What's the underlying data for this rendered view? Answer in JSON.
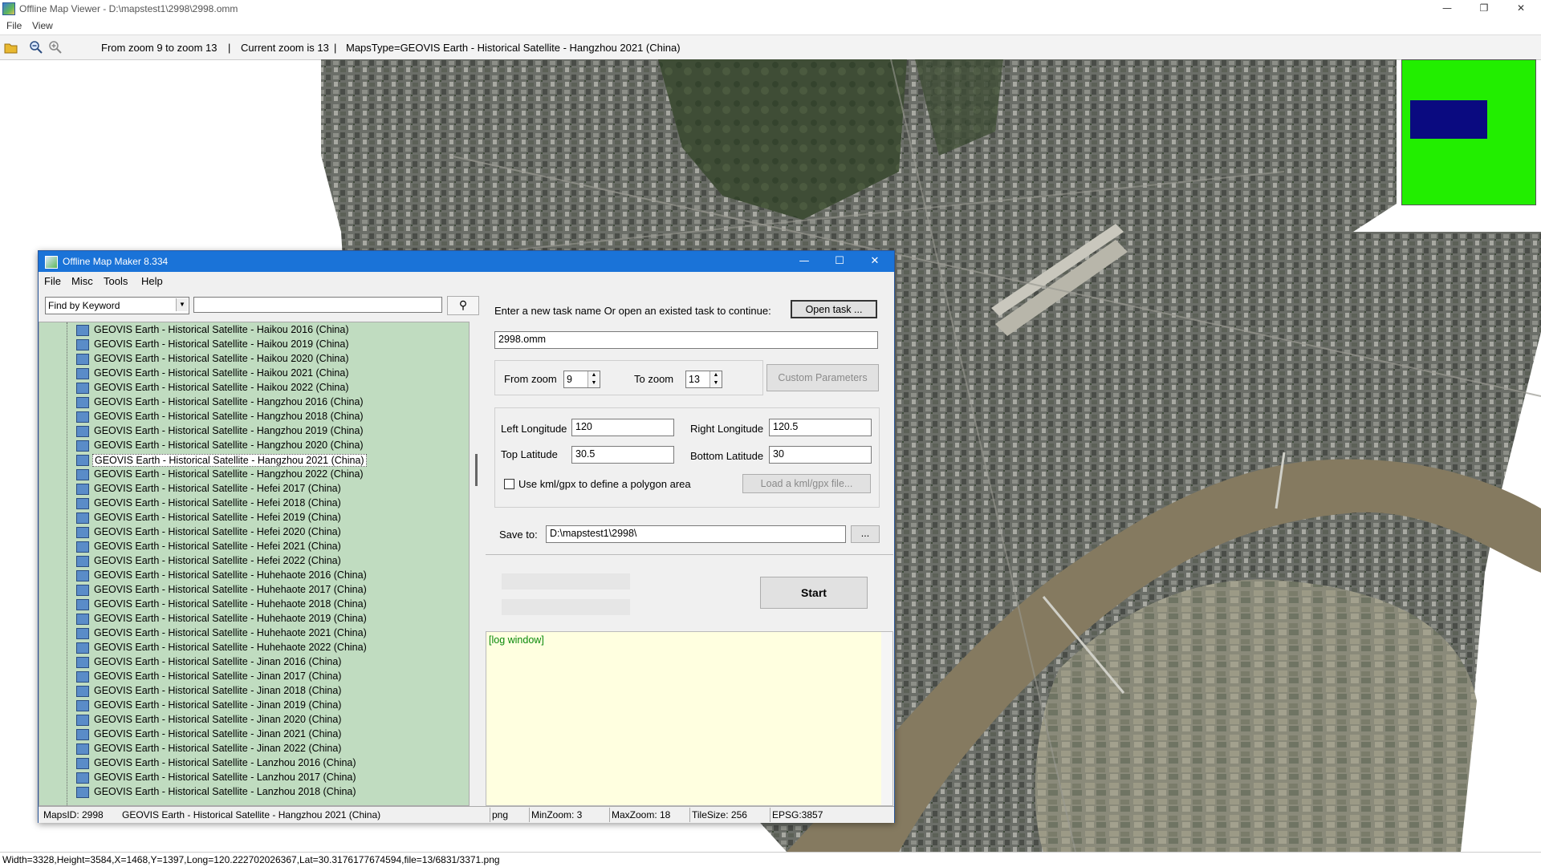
{
  "window": {
    "title": "Offline Map Viewer - D:\\mapstest1\\2998\\2998.omm"
  },
  "menu": [
    "File",
    "View"
  ],
  "toolbar": {
    "zoom_range": "From zoom 9 to zoom 13",
    "current_zoom": "Current zoom is 13",
    "maps_type": "MapsType=GEOVIS Earth - Historical Satellite - Hangzhou 2021 (China)"
  },
  "status": "Width=3328,Height=3584,X=1468,Y=1397,Long=120.222702026367,Lat=30.3176177674594,file=13/6831/3371.png",
  "dialog": {
    "title": "Offline Map Maker 8.334",
    "menu": [
      "File",
      "Misc",
      "Tools",
      "Help"
    ],
    "find_by": "Find by Keyword",
    "search_value": "",
    "tree_items": [
      "GEOVIS Earth - Historical Satellite - Haikou 2016 (China)",
      "GEOVIS Earth - Historical Satellite - Haikou 2019 (China)",
      "GEOVIS Earth - Historical Satellite - Haikou 2020 (China)",
      "GEOVIS Earth - Historical Satellite - Haikou 2021 (China)",
      "GEOVIS Earth - Historical Satellite - Haikou 2022 (China)",
      "GEOVIS Earth - Historical Satellite - Hangzhou 2016 (China)",
      "GEOVIS Earth - Historical Satellite - Hangzhou 2018 (China)",
      "GEOVIS Earth - Historical Satellite - Hangzhou 2019 (China)",
      "GEOVIS Earth - Historical Satellite - Hangzhou 2020 (China)",
      "GEOVIS Earth - Historical Satellite - Hangzhou 2021 (China)",
      "GEOVIS Earth - Historical Satellite - Hangzhou 2022 (China)",
      "GEOVIS Earth - Historical Satellite - Hefei 2017 (China)",
      "GEOVIS Earth - Historical Satellite - Hefei 2018 (China)",
      "GEOVIS Earth - Historical Satellite - Hefei 2019 (China)",
      "GEOVIS Earth - Historical Satellite - Hefei 2020 (China)",
      "GEOVIS Earth - Historical Satellite - Hefei 2021 (China)",
      "GEOVIS Earth - Historical Satellite - Hefei 2022 (China)",
      "GEOVIS Earth - Historical Satellite - Huhehaote 2016 (China)",
      "GEOVIS Earth - Historical Satellite - Huhehaote 2017 (China)",
      "GEOVIS Earth - Historical Satellite - Huhehaote 2018 (China)",
      "GEOVIS Earth - Historical Satellite - Huhehaote 2019 (China)",
      "GEOVIS Earth - Historical Satellite - Huhehaote 2021 (China)",
      "GEOVIS Earth - Historical Satellite - Huhehaote 2022 (China)",
      "GEOVIS Earth - Historical Satellite - Jinan 2016 (China)",
      "GEOVIS Earth - Historical Satellite - Jinan 2017 (China)",
      "GEOVIS Earth - Historical Satellite - Jinan 2018 (China)",
      "GEOVIS Earth - Historical Satellite - Jinan 2019 (China)",
      "GEOVIS Earth - Historical Satellite - Jinan 2020 (China)",
      "GEOVIS Earth - Historical Satellite - Jinan 2021 (China)",
      "GEOVIS Earth - Historical Satellite - Jinan 2022 (China)",
      "GEOVIS Earth - Historical Satellite - Lanzhou 2016 (China)",
      "GEOVIS Earth - Historical Satellite - Lanzhou 2017 (China)",
      "GEOVIS Earth - Historical Satellite - Lanzhou 2018 (China)"
    ],
    "selected_item": "GEOVIS Earth - Historical Satellite - Hangzhou 2021 (China)",
    "task_prompt": "Enter a new task name Or open an existed task to continue:",
    "open_task": "Open task ...",
    "task_name": "2998.omm",
    "from_zoom_label": "From zoom",
    "from_zoom": "9",
    "to_zoom_label": "To zoom",
    "to_zoom": "13",
    "custom_params": "Custom Parameters",
    "left_lon_label": "Left Longitude",
    "left_lon": "120",
    "right_lon_label": "Right Longitude",
    "right_lon": "120.5",
    "top_lat_label": "Top Latitude",
    "top_lat": "30.5",
    "bottom_lat_label": "Bottom Latitude",
    "bottom_lat": "30",
    "kml_label": "Use kml/gpx to define a polygon area",
    "load_kml": "Load a kml/gpx file...",
    "save_to_label": "Save to:",
    "save_to": "D:\\mapstest1\\2998\\",
    "browse": "...",
    "start": "Start",
    "log": "[log window]",
    "status": {
      "maps_id": "MapsID: 2998",
      "map_name": "GEOVIS Earth - Historical Satellite - Hangzhou 2021 (China)",
      "format": "png",
      "min_zoom": "MinZoom: 3",
      "max_zoom": "MaxZoom: 18",
      "tile_size": "TileSize: 256",
      "epsg": "EPSG:3857"
    }
  },
  "colors": {
    "tree_bg": "#c0dcc0",
    "dialog_titlebar": "#1a73d8",
    "minimap_bg": "#22ee00",
    "minimap_view": "#0a0a80",
    "log_bg": "#ffffe0"
  },
  "icons": [
    "open-folder-icon",
    "zoom-out-icon",
    "zoom-in-icon",
    "search-icon"
  ]
}
